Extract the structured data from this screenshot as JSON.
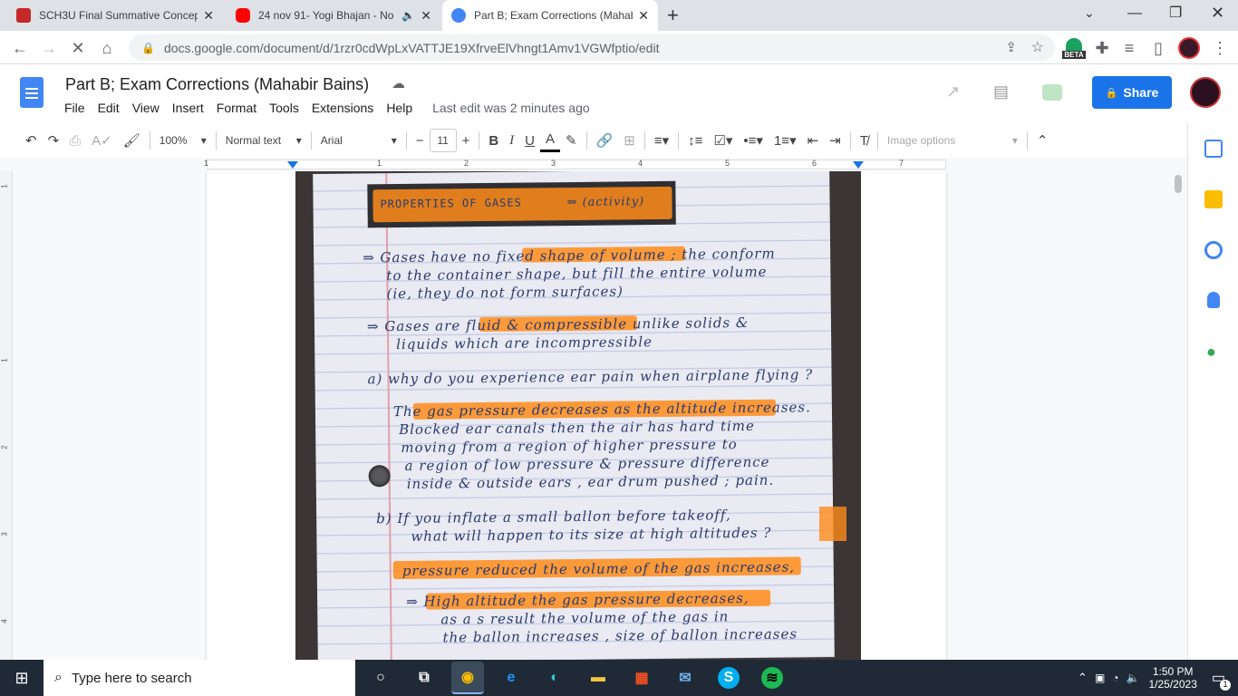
{
  "browser": {
    "tabs": [
      {
        "title": "SCH3U Final Summative Concept",
        "icon": "school-icon",
        "active": false
      },
      {
        "title": "24 nov 91- Yogi Bhajan - No",
        "icon": "youtube-icon",
        "active": false
      },
      {
        "title": "Part B; Exam Corrections (Mahabi",
        "icon": "docs-icon",
        "active": true
      }
    ],
    "url": "docs.google.com/document/d/1rzr0cdWpLxVATTJE19XfrveElVhngt1Amv1VGWfptio/edit",
    "beta_badge": "BETA"
  },
  "doc": {
    "title": "Part B; Exam Corrections (Mahabir Bains)",
    "menu": [
      "File",
      "Edit",
      "View",
      "Insert",
      "Format",
      "Tools",
      "Extensions",
      "Help"
    ],
    "last_edit": "Last edit was 2 minutes ago",
    "share_label": "Share"
  },
  "toolbar": {
    "zoom": "100%",
    "style": "Normal text",
    "font": "Arial",
    "font_size": "11",
    "image_options": "Image options"
  },
  "ruler": {
    "marks": [
      "1",
      "1",
      "2",
      "3",
      "4",
      "5",
      "6",
      "7"
    ]
  },
  "vruler": {
    "marks": [
      "1",
      "1",
      "2",
      "3",
      "4"
    ]
  },
  "notes": {
    "heading": "PROPERTIES OF GASES",
    "heading_suffix": "⇒ (activity)",
    "lines": [
      "⇒ Gases  have no  fixed shape of volume ; the conform",
      "to the container shape, but fill the  entire volume",
      "(ie, they do not  form  surfaces)",
      "⇒  Gases  are fluid & compressible  unlike solids &",
      "liquids  which are  incompressible",
      "a)  why do you experience ear pain  when airplane  flying ?",
      "The gas pressure  decreases as the altitude  increases.",
      "Blocked ear canals  then the air  has hard time",
      "moving  from a region of higher pressure to",
      "a region of low  pressure  &  pressure difference",
      "inside  & outside ears , ear drum  pushed ; pain.",
      "b)  If you inflate a small ballon before takeoff,",
      "what will happen  to its size at high altitudes ?",
      "pressure  reduced  the volume  of the gas increases,",
      "⇒  High altitude  the  gas pressure  decreases,",
      "as a s result  the  volume of the gas  in",
      "the ballon  increases , size of ballon  increases"
    ]
  },
  "taskbar": {
    "search_placeholder": "Type here to search",
    "time": "1:50 PM",
    "date": "1/25/2023",
    "notification_count": "1"
  },
  "colors": {
    "accent": "#1a73e8",
    "highlight": "#ff8c1a",
    "taskbar": "#1f2a36"
  }
}
